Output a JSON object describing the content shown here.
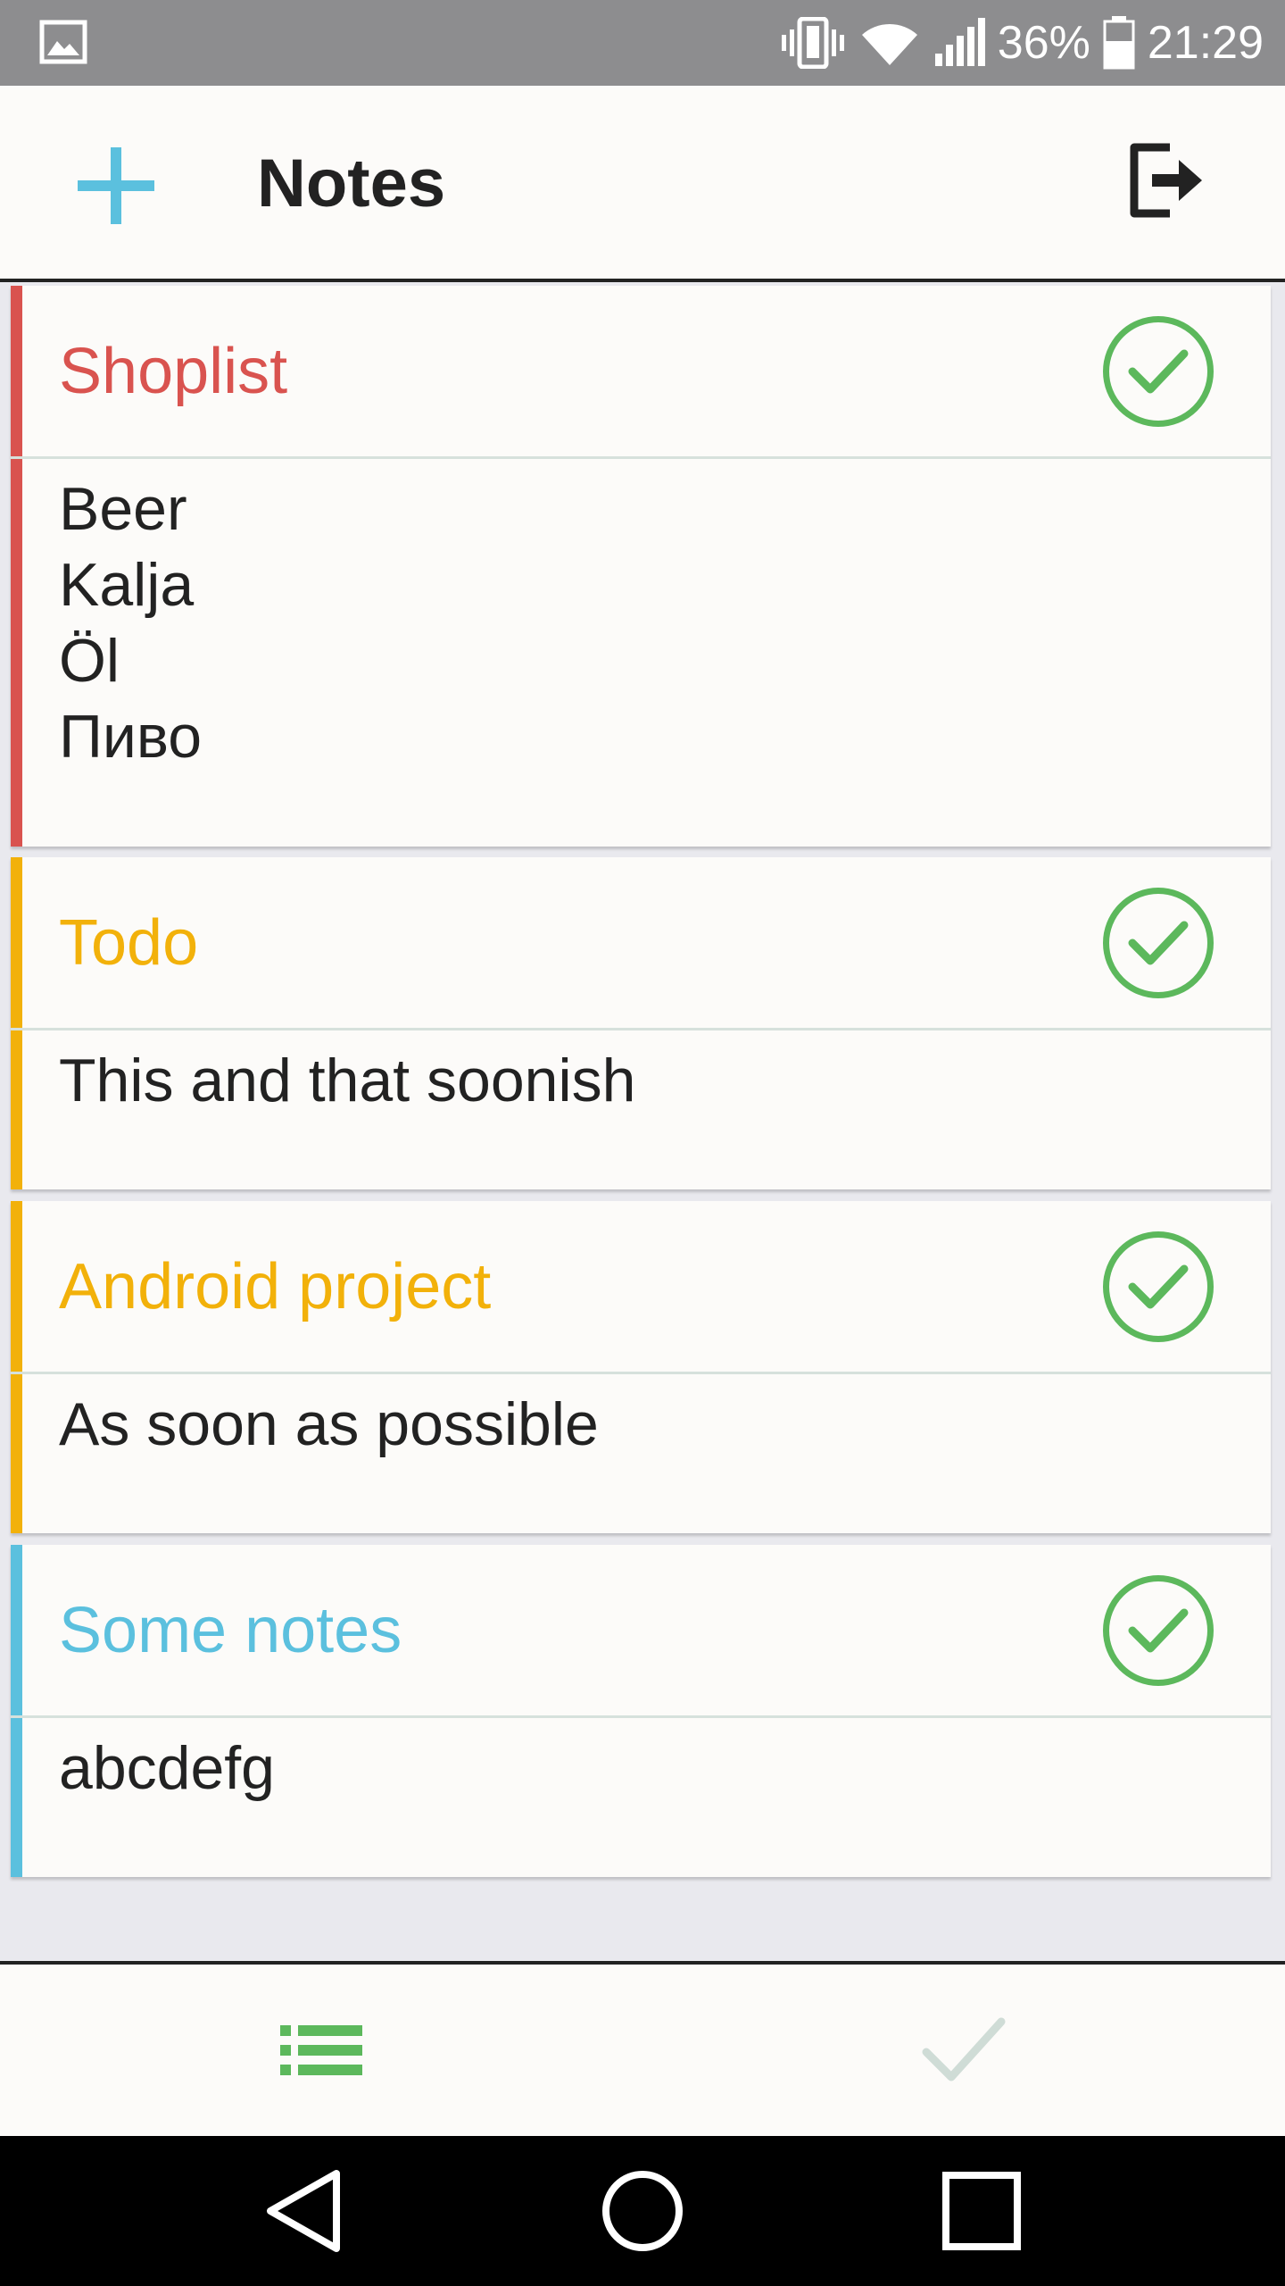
{
  "status_bar": {
    "battery": "36%",
    "time": "21:29"
  },
  "app_bar": {
    "title": "Notes",
    "add_icon": "plus-icon",
    "logout_icon": "logout-icon"
  },
  "colors": {
    "red": "#d9534f",
    "yellow": "#f0ad00",
    "blue": "#5bc0de",
    "green": "#5cb85c"
  },
  "notes": [
    {
      "title": "Shoplist",
      "color": "#d9534f",
      "body": "Beer\nKalja\nÖl\nПиво"
    },
    {
      "title": "Todo",
      "color": "#f2b10a",
      "body": "This and that soonish"
    },
    {
      "title": "Android project",
      "color": "#f2b10a",
      "body": "As soon as possible"
    },
    {
      "title": "Some notes",
      "color": "#5bc0de",
      "body": "abcdefg"
    }
  ],
  "bottom_nav": {
    "items": [
      {
        "icon": "list-icon",
        "active": true
      },
      {
        "icon": "check-icon",
        "active": false
      }
    ]
  },
  "system_nav": {
    "items": [
      "back-icon",
      "home-icon",
      "recents-icon"
    ]
  }
}
